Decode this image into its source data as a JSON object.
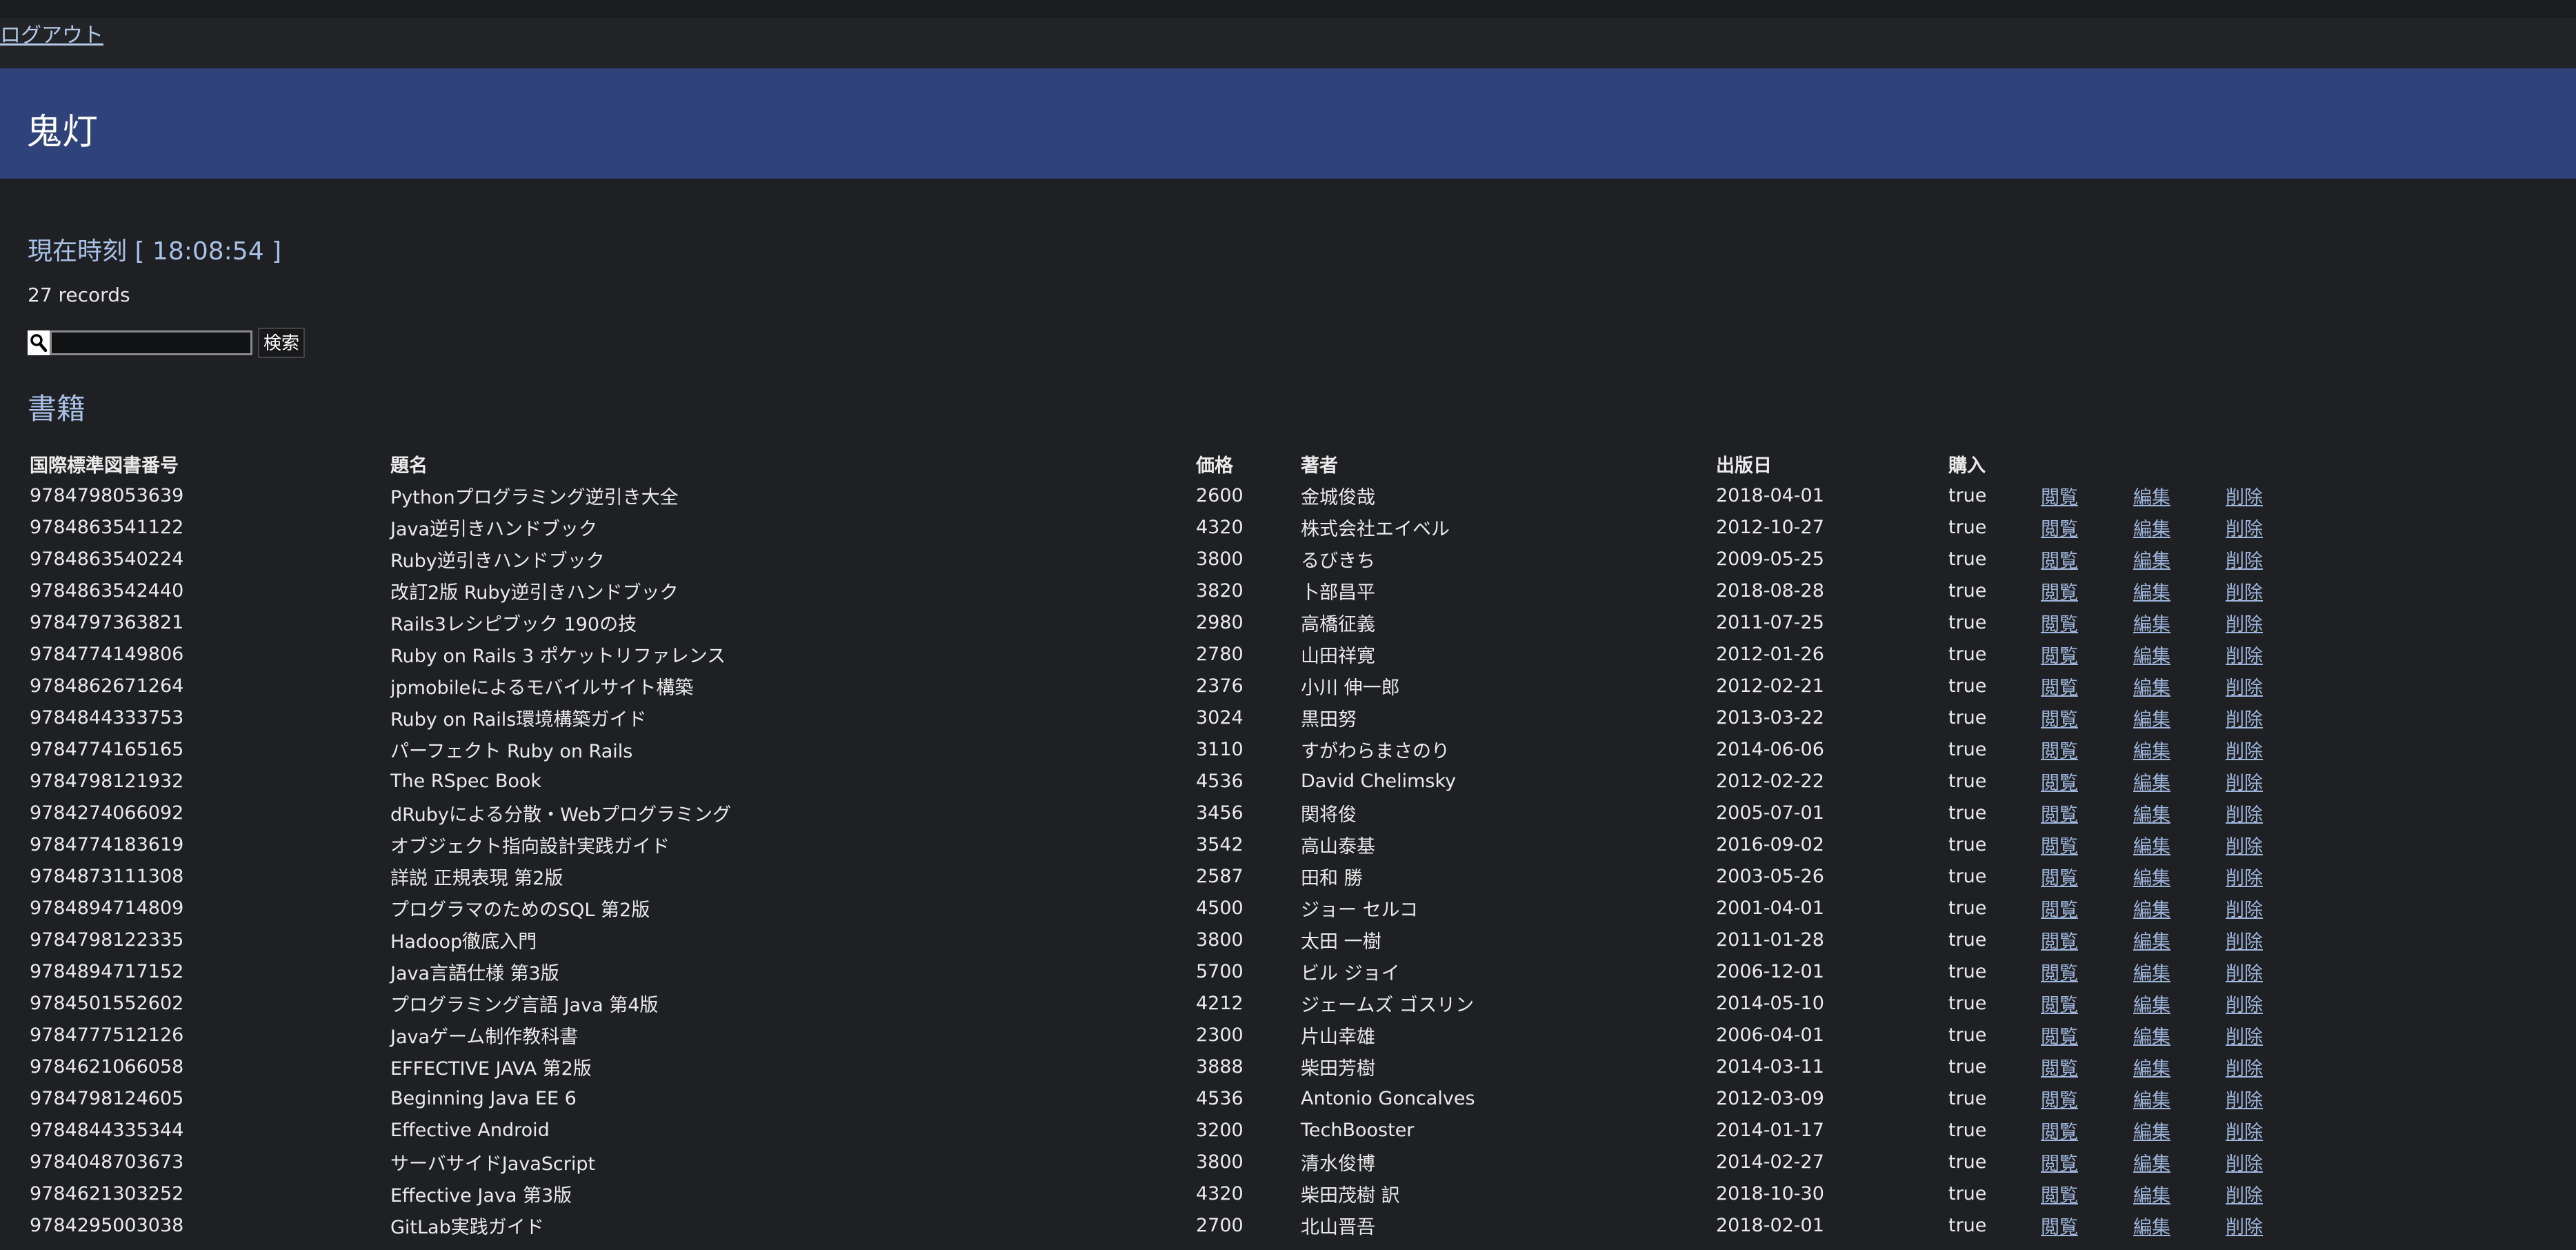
{
  "nav": {
    "logout": "ログアウト"
  },
  "header": {
    "title": "鬼灯"
  },
  "clock": "現在時刻 [ 18:08:54 ]",
  "record_count": "27 records",
  "search": {
    "button": "検索",
    "value": ""
  },
  "section_title": "書籍",
  "table": {
    "headers": [
      "国際標準図書番号",
      "題名",
      "価格",
      "著者",
      "出版日",
      "購入"
    ],
    "link_labels": {
      "view": "閲覧",
      "edit": "編集",
      "delete": "削除"
    },
    "rows": [
      [
        "9784798053639",
        "Pythonプログラミング逆引き大全",
        "2600",
        "金城俊哉",
        "2018-04-01",
        "true"
      ],
      [
        "9784863541122",
        "Java逆引きハンドブック",
        "4320",
        "株式会社エイベル",
        "2012-10-27",
        "true"
      ],
      [
        "9784863540224",
        "Ruby逆引きハンドブック",
        "3800",
        "るびきち",
        "2009-05-25",
        "true"
      ],
      [
        "9784863542440",
        "改訂2版 Ruby逆引きハンドブック",
        "3820",
        "卜部昌平",
        "2018-08-28",
        "true"
      ],
      [
        "9784797363821",
        "Rails3レシピブック 190の技",
        "2980",
        "高橋征義",
        "2011-07-25",
        "true"
      ],
      [
        "9784774149806",
        "Ruby on Rails 3 ポケットリファレンス",
        "2780",
        "山田祥寛",
        "2012-01-26",
        "true"
      ],
      [
        "9784862671264",
        "jpmobileによるモバイルサイト構築",
        "2376",
        "小川 伸一郎",
        "2012-02-21",
        "true"
      ],
      [
        "9784844333753",
        "Ruby on Rails環境構築ガイド",
        "3024",
        "黒田努",
        "2013-03-22",
        "true"
      ],
      [
        "9784774165165",
        "パーフェクト Ruby on Rails",
        "3110",
        "すがわらまさのり",
        "2014-06-06",
        "true"
      ],
      [
        "9784798121932",
        "The RSpec Book",
        "4536",
        "David Chelimsky",
        "2012-02-22",
        "true"
      ],
      [
        "9784274066092",
        "dRubyによる分散・Webプログラミング",
        "3456",
        "関将俊",
        "2005-07-01",
        "true"
      ],
      [
        "9784774183619",
        "オブジェクト指向設計実践ガイド",
        "3542",
        "高山泰基",
        "2016-09-02",
        "true"
      ],
      [
        "9784873111308",
        "詳説 正規表現 第2版",
        "2587",
        "田和 勝",
        "2003-05-26",
        "true"
      ],
      [
        "9784894714809",
        "プログラマのためのSQL 第2版",
        "4500",
        "ジョー セルコ",
        "2001-04-01",
        "true"
      ],
      [
        "9784798122335",
        "Hadoop徹底入門",
        "3800",
        "太田 一樹",
        "2011-01-28",
        "true"
      ],
      [
        "9784894717152",
        "Java言語仕様 第3版",
        "5700",
        "ビル ジョイ",
        "2006-12-01",
        "true"
      ],
      [
        "9784501552602",
        "プログラミング言語 Java 第4版",
        "4212",
        "ジェームズ ゴスリン",
        "2014-05-10",
        "true"
      ],
      [
        "9784777512126",
        "Javaゲーム制作教科書",
        "2300",
        "片山幸雄",
        "2006-04-01",
        "true"
      ],
      [
        "9784621066058",
        "EFFECTIVE JAVA 第2版",
        "3888",
        "柴田芳樹",
        "2014-03-11",
        "true"
      ],
      [
        "9784798124605",
        "Beginning Java EE 6",
        "4536",
        "Antonio Goncalves",
        "2012-03-09",
        "true"
      ],
      [
        "9784844335344",
        "Effective Android",
        "3200",
        "TechBooster",
        "2014-01-17",
        "true"
      ],
      [
        "9784048703673",
        "サーバサイドJavaScript",
        "3800",
        "清水俊博",
        "2014-02-27",
        "true"
      ],
      [
        "9784621303252",
        "Effective Java 第3版",
        "4320",
        "柴田茂樹 訳",
        "2018-10-30",
        "true"
      ],
      [
        "9784295003038",
        "GitLab実践ガイド",
        "2700",
        "北山晋吾",
        "2018-02-01",
        "true"
      ]
    ]
  }
}
